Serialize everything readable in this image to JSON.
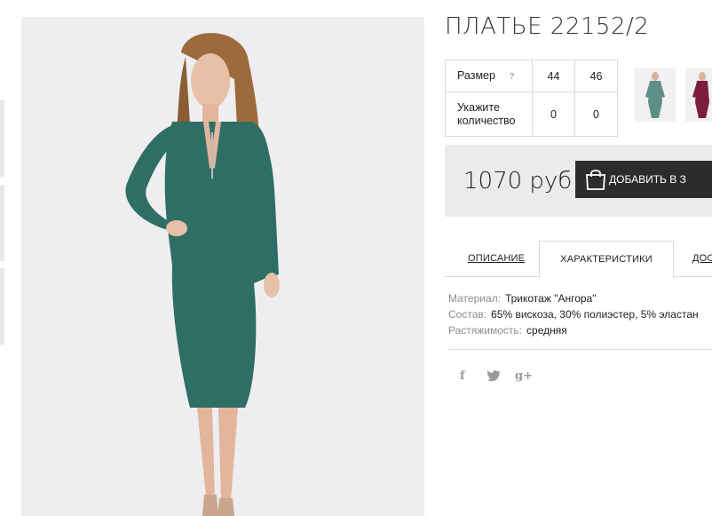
{
  "product": {
    "title": "ПЛАТЬЕ 22152/2",
    "size_label": "Размер",
    "size_help": "?",
    "sizes": [
      "44",
      "46"
    ],
    "qty_label": "Укажите количество",
    "quantities": [
      "0",
      "0"
    ],
    "price": "1070 руб",
    "add_button": "ДОБАВИТЬ В З",
    "colors": {
      "dress_main": "#2f6e64",
      "dress_alt": "#7a1e3c",
      "button_bg": "#2c2c2c",
      "price_bar_bg": "#ebebec"
    }
  },
  "tabs": {
    "description": "ОПИСАНИЕ",
    "characteristics": "ХАРАКТЕРИСТИКИ",
    "delivery": "ДОС"
  },
  "characteristics": [
    {
      "key": "Материал:",
      "value": "Трикотаж \"Ангора\""
    },
    {
      "key": "Состав:",
      "value": "65% вискоза, 30% полиэстер, 5% эластан"
    },
    {
      "key": "Растяжимость:",
      "value": "средняя"
    }
  ],
  "social": {
    "facebook": "f",
    "twitter": "🐦",
    "googleplus": "g+"
  }
}
